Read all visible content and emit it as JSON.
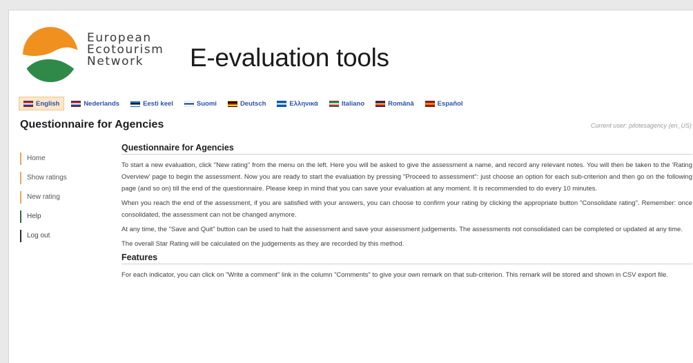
{
  "logo": {
    "lines": [
      "European",
      "Ecotourism",
      "Network"
    ],
    "colors": {
      "sun": "#f0901f",
      "hill": "#2f8a4a"
    }
  },
  "site_title": "E-evaluation tools",
  "languages": [
    {
      "label": "English",
      "active": true,
      "flag": [
        "#b22234",
        "#ffffff",
        "#3c3b6e"
      ]
    },
    {
      "label": "Nederlands",
      "active": false,
      "flag": [
        "#ae1c28",
        "#ffffff",
        "#21468b"
      ]
    },
    {
      "label": "Eesti keel",
      "active": false,
      "flag": [
        "#0072ce",
        "#000000",
        "#ffffff"
      ]
    },
    {
      "label": "Suomi",
      "active": false,
      "flag": [
        "#ffffff",
        "#003580",
        "#ffffff"
      ]
    },
    {
      "label": "Deutsch",
      "active": false,
      "flag": [
        "#000000",
        "#dd0000",
        "#ffce00"
      ]
    },
    {
      "label": "Ελληνικά",
      "active": false,
      "flag": [
        "#0d5eaf",
        "#ffffff",
        "#0d5eaf"
      ]
    },
    {
      "label": "Italiano",
      "active": false,
      "flag": [
        "#009246",
        "#ffffff",
        "#ce2b37"
      ]
    },
    {
      "label": "Română",
      "active": false,
      "flag": [
        "#002b7f",
        "#fcd116",
        "#ce1126"
      ]
    },
    {
      "label": "Español",
      "active": false,
      "flag": [
        "#aa151b",
        "#f1bf00",
        "#aa151b"
      ]
    }
  ],
  "page_heading": "Questionnaire for Agencies",
  "current_user": "Current user: pilotesagency (en_US)",
  "sidebar": {
    "items": [
      {
        "label": "Home",
        "style": "orange"
      },
      {
        "label": "Show ratings",
        "style": "orange"
      },
      {
        "label": "New rating",
        "style": "orange"
      },
      {
        "label": "Help",
        "style": "green"
      },
      {
        "label": "Log out",
        "style": "black"
      }
    ]
  },
  "main": {
    "section1_title": "Questionnaire for Agencies",
    "paragraphs": [
      "To start a new evaluation, click \"New rating\" from the menu on the left. Here you will be asked to give the assessment a name, and record any relevant notes. You will then be taken to the 'Rating Overview' page to begin the assessment. Now you are ready to start the evaluation by pressing \"Proceed to assessment\": just choose an option for each sub-criterion and then go on the following page (and so on) till the end of the questionnaire. Please keep in mind that you can save your evaluation at any moment. It is recommended to do every 10 minutes.",
      "When you reach the end of the assessment, if you are satisfied with your answers, you can choose to confirm your rating by clicking the appropriate button \"Consolidate rating\". Remember: once consolidated, the assessment can not be changed anymore.",
      "At any time, the \"Save and Quit\" button can be used to halt the assessment and save your assessment judgements. The assessments not consolidated can be completed or updated at any time.",
      "The overall Star Rating will be calculated on the judgements as they are recorded by this method."
    ],
    "section2_title": "Features",
    "features_paragraph": "For each indicator, you can click on \"Write a comment\" link in the column \"Comments\" to give your own remark on that sub-criterion. This remark will be stored and shown in CSV export file."
  }
}
